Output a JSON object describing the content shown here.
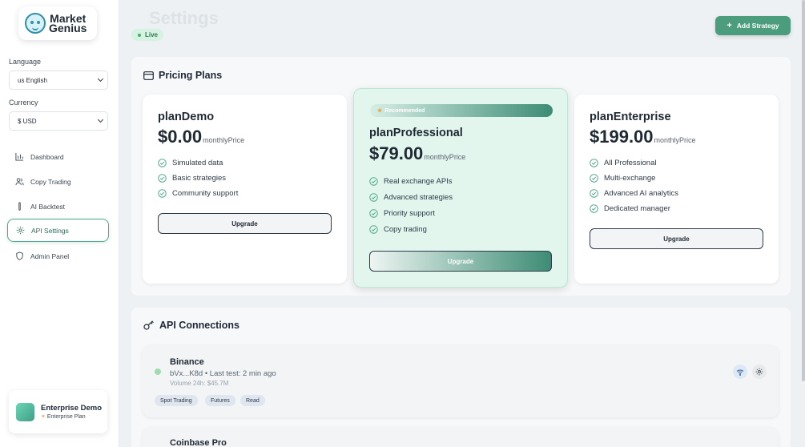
{
  "brand": {
    "line1": "Market",
    "line2": "Genius"
  },
  "sidebar": {
    "language_label": "Language",
    "language_value": "us English",
    "currency_label": "Currency",
    "currency_value": "$ USD",
    "nav": [
      {
        "label": "Dashboard",
        "icon": "bar-chart-icon"
      },
      {
        "label": "Copy Trading",
        "icon": "users-icon"
      },
      {
        "label": "AI Backtest",
        "icon": "flask-icon"
      },
      {
        "label": "API Settings",
        "icon": "gear-icon",
        "active": true
      },
      {
        "label": "Admin Panel",
        "icon": "shield-icon"
      }
    ],
    "user": {
      "name": "Enterprise Demo",
      "plan": "Enterprise Plan"
    }
  },
  "header": {
    "ghost_title": "Settings",
    "live": "Live",
    "add_strategy": "Add Strategy"
  },
  "pricing": {
    "title": "Pricing Plans",
    "plans": [
      {
        "name": "planDemo",
        "price": "$0.00",
        "unit": "monthlyPrice",
        "features": [
          "Simulated data",
          "Basic strategies",
          "Community support"
        ],
        "button": "Upgrade"
      },
      {
        "name": "planProfessional",
        "price": "$79.00",
        "unit": "monthlyPrice",
        "badge": "Recommended",
        "features": [
          "Real exchange APIs",
          "Advanced strategies",
          "Priority support",
          "Copy trading"
        ],
        "button": "Upgrade"
      },
      {
        "name": "planEnterprise",
        "price": "$199.00",
        "unit": "monthlyPrice",
        "features": [
          "All Professional",
          "Multi-exchange",
          "Advanced AI analytics",
          "Dedicated manager"
        ],
        "button": "Upgrade"
      }
    ]
  },
  "api": {
    "title": "API Connections",
    "connections": [
      {
        "name": "Binance",
        "info": "bVx...K8d • Last test: 2 min ago",
        "volume": "Volume 24h: $45.7M",
        "tags": [
          "Spot Trading",
          "Futures",
          "Read"
        ]
      },
      {
        "name": "Coinbase Pro"
      }
    ]
  },
  "colors": {
    "accent": "#4b9d7d",
    "live_bg": "#d6f2e1",
    "recommended_bg": "#e3f6ee"
  }
}
